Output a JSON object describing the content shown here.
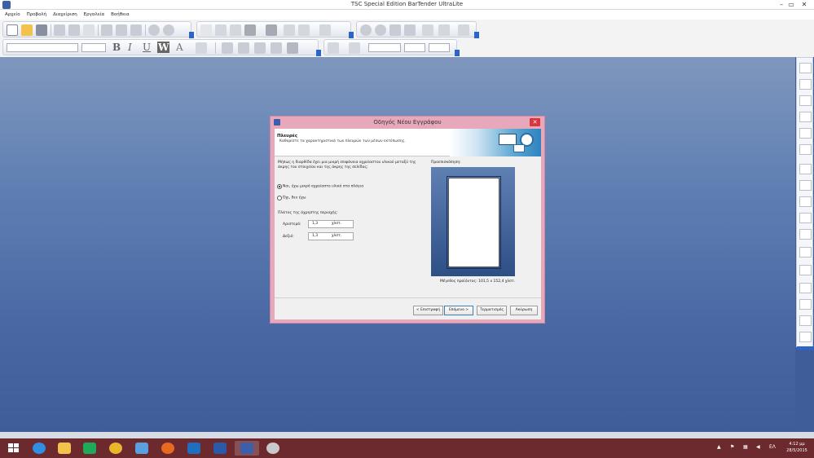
{
  "window": {
    "title": "TSC Special Edition BarTender UltraLite",
    "min": "–",
    "max": "▭",
    "close": "✕"
  },
  "menu": [
    "Αρχείο",
    "Προβολή",
    "Διαχείριση",
    "Εργαλεία",
    "Βοήθεια"
  ],
  "toolbar_format": {
    "bold": "B",
    "italic": "I",
    "underline": "U",
    "w": "W",
    "font_color": "A"
  },
  "dialog": {
    "title": "Οδηγός Νέου Εγγράφου",
    "close": "✕",
    "header_title": "Πλευρές",
    "header_subtitle": "Καθορίστε τα χαρακτηριστικά των πλευρών των μέσων εκτύπωσης.",
    "question": "Μήπως η διαρθίδα έχει μια μικρή επιφάνεια αχρείαστου υλικού μεταξύ της άκρης του στοιχείου και της άκρης της σελίδας;",
    "options": [
      {
        "label": "Ναι, έχω μικρό αχρείαστο υλικό στα πλάγια",
        "selected": true
      },
      {
        "label": "Όχι, δεν έχω",
        "selected": false
      }
    ],
    "group_label": "Πλάτος της άχρηστης περιοχής:",
    "fields": [
      {
        "label": "Αριστερό:",
        "value": "1,3",
        "unit": "χλστ."
      },
      {
        "label": "Δεξιό:",
        "value": "1,3",
        "unit": "χλστ."
      }
    ],
    "preview_label": "Προεπισκόπηση:",
    "size_text": "Μέγεθος προϊόντος: 101,5 x 152,4 χλστ.",
    "buttons": {
      "back": "< Επιστροφή",
      "next": "Επόμενο >",
      "finish": "Τερματισμός",
      "cancel": "Ακύρωση"
    }
  },
  "taskbar": {
    "apps": [
      "windows-start",
      "internet-explorer",
      "file-explorer",
      "store",
      "chrome",
      "visual-studio",
      "firefox",
      "outlook",
      "word",
      "bartender",
      "paint"
    ],
    "language": "ΕΛ",
    "time": "4:12 μμ",
    "date": "28/5/2015"
  }
}
